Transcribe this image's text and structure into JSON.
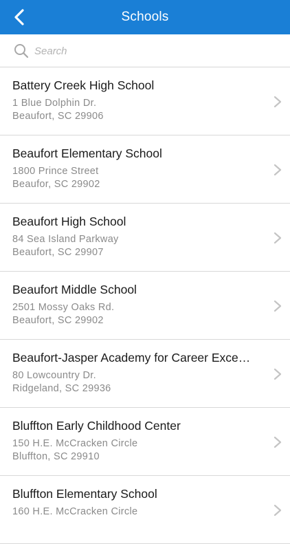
{
  "header": {
    "title": "Schools",
    "back_icon": "chevron-left-icon"
  },
  "search": {
    "placeholder": "Search",
    "value": "",
    "icon": "search-icon"
  },
  "colors": {
    "navbar": "#1a7fd6",
    "title_text": "#ffffff",
    "secondary_text": "#8a8a8a",
    "chevron": "#c4c4c4",
    "separator": "#d8d8d8"
  },
  "schools": [
    {
      "name": "Battery Creek High School",
      "address1": "1 Blue Dolphin Dr.",
      "address2": "Beaufort, SC 29906"
    },
    {
      "name": "Beaufort Elementary School",
      "address1": "1800 Prince Street",
      "address2": "Beaufor, SC 29902"
    },
    {
      "name": "Beaufort High School",
      "address1": "84 Sea Island Parkway",
      "address2": "Beaufort, SC 29907"
    },
    {
      "name": "Beaufort Middle School",
      "address1": "2501 Mossy Oaks Rd.",
      "address2": "Beaufort, SC 29902"
    },
    {
      "name": "Beaufort-Jasper Academy for Career Exce…",
      "address1": "80 Lowcountry Dr.",
      "address2": "Ridgeland, SC 29936"
    },
    {
      "name": "Bluffton Early Childhood Center",
      "address1": "150 H.E. McCracken Circle",
      "address2": "Bluffton, SC 29910"
    },
    {
      "name": "Bluffton Elementary School",
      "address1": "160 H.E. McCracken Circle",
      "address2": ""
    }
  ]
}
